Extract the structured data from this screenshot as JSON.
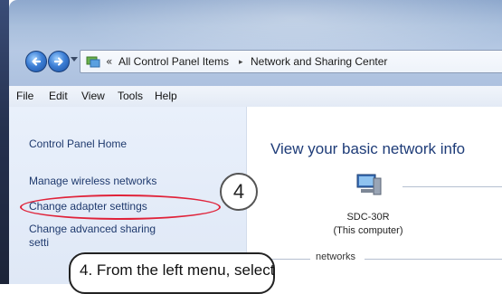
{
  "address_bar": {
    "icon": "control-panel-icon",
    "overflow_chevron": "«",
    "crumbs": [
      "All Control Panel Items",
      "Network and Sharing Center"
    ],
    "separator": "▸"
  },
  "menu": [
    "File",
    "Edit",
    "View",
    "Tools",
    "Help"
  ],
  "left_pane": {
    "home": "Control Panel Home",
    "links": [
      "Manage wireless networks",
      "Change adapter settings",
      "Change advanced sharing",
      "setti"
    ]
  },
  "main": {
    "title": "View your basic network info",
    "computer_name": "SDC-30R",
    "computer_sub": "(This computer)",
    "networks_label": "networks"
  },
  "annotation": {
    "step_number": "4",
    "callout": "4.  From the left menu, select",
    "highlight_color": "#e0233a"
  }
}
